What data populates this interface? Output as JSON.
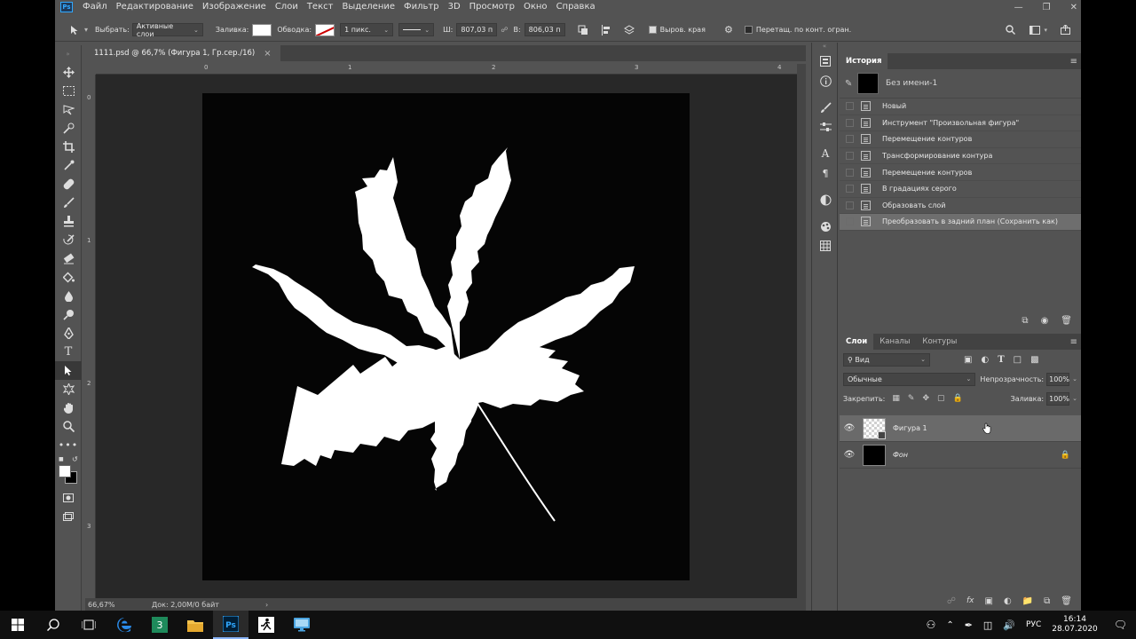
{
  "menubar": {
    "logo": "Ps",
    "items": [
      "Файл",
      "Редактирование",
      "Изображение",
      "Слои",
      "Текст",
      "Выделение",
      "Фильтр",
      "3D",
      "Просмотр",
      "Окно",
      "Справка"
    ]
  },
  "options": {
    "select_label": "Выбрать:",
    "select_value": "Активные слои",
    "fill_label": "Заливка:",
    "stroke_label": "Обводка:",
    "stroke_size": "1 пикс.",
    "w_label": "Ш:",
    "w_value": "807,03 п",
    "h_label": "В:",
    "h_value": "806,03 п",
    "align_edges_label": "Выров. края",
    "drag_label": "Перетащ. по конт. огран."
  },
  "document": {
    "tab_title": "1111.psd @ 66,7% (Фигура 1, Гр.сер./16)",
    "close_glyph": "×",
    "zoom": "66,67%",
    "doc_info": "Док: 2,00M/0 байт",
    "ruler_top": [
      "0",
      "1",
      "2",
      "3",
      "4"
    ],
    "ruler_left": [
      "0",
      "1",
      "2",
      "3"
    ]
  },
  "history": {
    "title": "История",
    "snapshot": "Без имени-1",
    "items": [
      "Новый",
      "Инструмент \"Произвольная фигура\"",
      "Перемещение контуров",
      "Трансформирование контура",
      "Перемещение контуров",
      "В градациях серого",
      "Образовать слой",
      "Преобразовать в задний план (Сохранить как)"
    ],
    "selected_index": 7
  },
  "layers": {
    "tabs": [
      "Слои",
      "Каналы",
      "Контуры"
    ],
    "filter_value": "Вид",
    "blend_mode": "Обычные",
    "opacity_label": "Непрозрачность:",
    "opacity_value": "100%",
    "lock_label": "Закрепить:",
    "fill_label": "Заливка:",
    "fill_value": "100%",
    "items": [
      {
        "name": "Фигура 1"
      },
      {
        "name": "Фон"
      }
    ]
  },
  "taskbar": {
    "time": "16:14",
    "date": "28.07.2020",
    "lang": "РУС"
  },
  "colors": {
    "panel_bg": "#535353",
    "canvas_bg": "#282828",
    "accent_ps": "#31a8ff",
    "leaf": "#ffffff"
  }
}
